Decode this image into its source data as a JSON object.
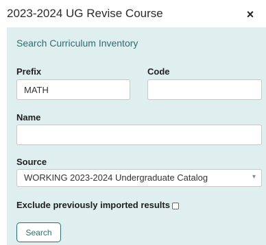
{
  "dialog": {
    "title": "2023-2024 UG Revise Course",
    "close_icon": "close-icon",
    "close_glyph": "×"
  },
  "search": {
    "heading": "Search Curriculum Inventory",
    "prefix": {
      "label": "Prefix",
      "value": "MATH",
      "placeholder": ""
    },
    "code": {
      "label": "Code",
      "value": "",
      "placeholder": ""
    },
    "name": {
      "label": "Name",
      "value": "",
      "placeholder": ""
    },
    "source": {
      "label": "Source",
      "selected": "WORKING 2023-2024 Undergraduate Catalog",
      "arrow_icon": "dropdown-arrow-icon",
      "arrow_glyph": "▾"
    },
    "exclude": {
      "label": "Exclude previously imported results",
      "checked": false
    },
    "button_label": "Search"
  },
  "colors": {
    "panel_background": "#dfeeee",
    "accent": "#2c6e6d"
  }
}
